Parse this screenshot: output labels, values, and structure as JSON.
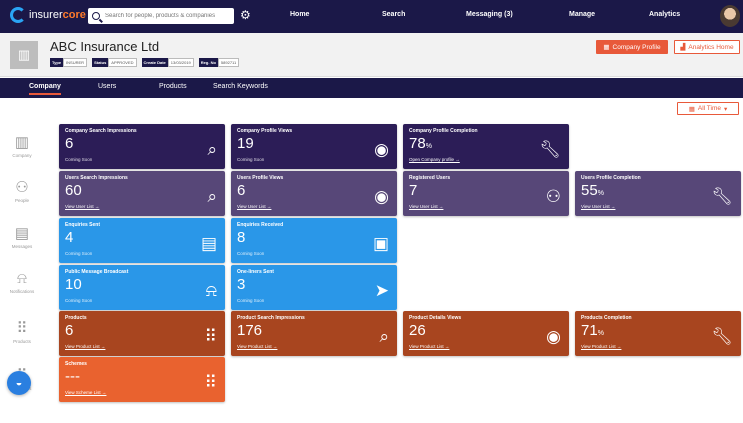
{
  "topbar": {
    "logo_plain": "insurer",
    "logo_bold": "core",
    "search_placeholder": "Search for people, products & companies",
    "nav": [
      "Home",
      "Search",
      "Messaging (3)",
      "Manage",
      "Analytics"
    ]
  },
  "header": {
    "company_name": "ABC Insurance Ltd",
    "tags": [
      {
        "key": "Type",
        "value": "INSURER"
      },
      {
        "key": "Status",
        "value": "APPROVED"
      },
      {
        "key": "Create Date",
        "value": "13/03/2019"
      },
      {
        "key": "Reg. No",
        "value": "5892711"
      }
    ],
    "company_profile_label": "Company Profile",
    "analytics_home_label": "Analytics Home"
  },
  "tabs": [
    "Company",
    "Users",
    "Products",
    "Search Keywords"
  ],
  "filter": {
    "label": "All Time"
  },
  "sidebar": [
    {
      "label": "Company",
      "icon": "building-icon"
    },
    {
      "label": "People",
      "icon": "people-icon"
    },
    {
      "label": "Messages",
      "icon": "message-icon"
    },
    {
      "label": "Notifications",
      "icon": "bell-icon"
    },
    {
      "label": "Products",
      "icon": "grid-icon"
    },
    {
      "label": "Schemes",
      "icon": "grid-icon"
    }
  ],
  "cards": [
    {
      "title": "Company Search Impressions",
      "value": "6",
      "unit": "",
      "footer": "Coming Soon",
      "icon": "search-icon",
      "color": "#2c1d57"
    },
    {
      "title": "Company Profile Views",
      "value": "19",
      "unit": "",
      "footer": "Coming Soon",
      "icon": "eye-icon",
      "color": "#2c1d57"
    },
    {
      "title": "Company Profile Completion",
      "value": "78",
      "unit": "%",
      "footer": "Open Company profile →",
      "icon": "wrench-icon",
      "color": "#2c1d57"
    },
    {
      "title": "Users Search Impressions",
      "value": "60",
      "unit": "",
      "footer": "View User List →",
      "icon": "search-icon",
      "color": "#574778"
    },
    {
      "title": "Users Profile Views",
      "value": "6",
      "unit": "",
      "footer": "View User List →",
      "icon": "eye-icon",
      "color": "#574778"
    },
    {
      "title": "Registered Users",
      "value": "7",
      "unit": "",
      "footer": "View User List →",
      "icon": "people-icon",
      "color": "#574778"
    },
    {
      "title": "Users Profile Completion",
      "value": "55",
      "unit": "%",
      "footer": "View User List →",
      "icon": "wrench-icon",
      "color": "#574778"
    },
    {
      "title": "Enquiries Sent",
      "value": "4",
      "unit": "",
      "footer": "Coming Soon",
      "icon": "message-icon",
      "color": "#2a97e8"
    },
    {
      "title": "Enquiries Received",
      "value": "8",
      "unit": "",
      "footer": "Coming Soon",
      "icon": "messages-icon",
      "color": "#2a97e8"
    },
    {
      "title": "Public Message Broadcast",
      "value": "10",
      "unit": "",
      "footer": "Coming Soon",
      "icon": "bell-icon",
      "color": "#2a97e8"
    },
    {
      "title": "One-liners Sent",
      "value": "3",
      "unit": "",
      "footer": "Coming Soon",
      "icon": "send-icon",
      "color": "#2a97e8"
    },
    {
      "title": "Products",
      "value": "6",
      "unit": "",
      "footer": "View Product List →",
      "icon": "grid-icon",
      "color": "#a8451f"
    },
    {
      "title": "Product Search Impressions",
      "value": "176",
      "unit": "",
      "footer": "View Product List →",
      "icon": "search-icon",
      "color": "#a8451f"
    },
    {
      "title": "Product Details Views",
      "value": "26",
      "unit": "",
      "footer": "View Product List →",
      "icon": "eye-icon",
      "color": "#a8451f"
    },
    {
      "title": "Products Completion",
      "value": "71",
      "unit": "%",
      "footer": "View Product List →",
      "icon": "wrench-icon",
      "color": "#a8451f"
    },
    {
      "title": "Schemes",
      "value": "---",
      "unit": "",
      "footer": "View Scheme List →",
      "icon": "grid-icon",
      "color": "#e9622f"
    }
  ]
}
